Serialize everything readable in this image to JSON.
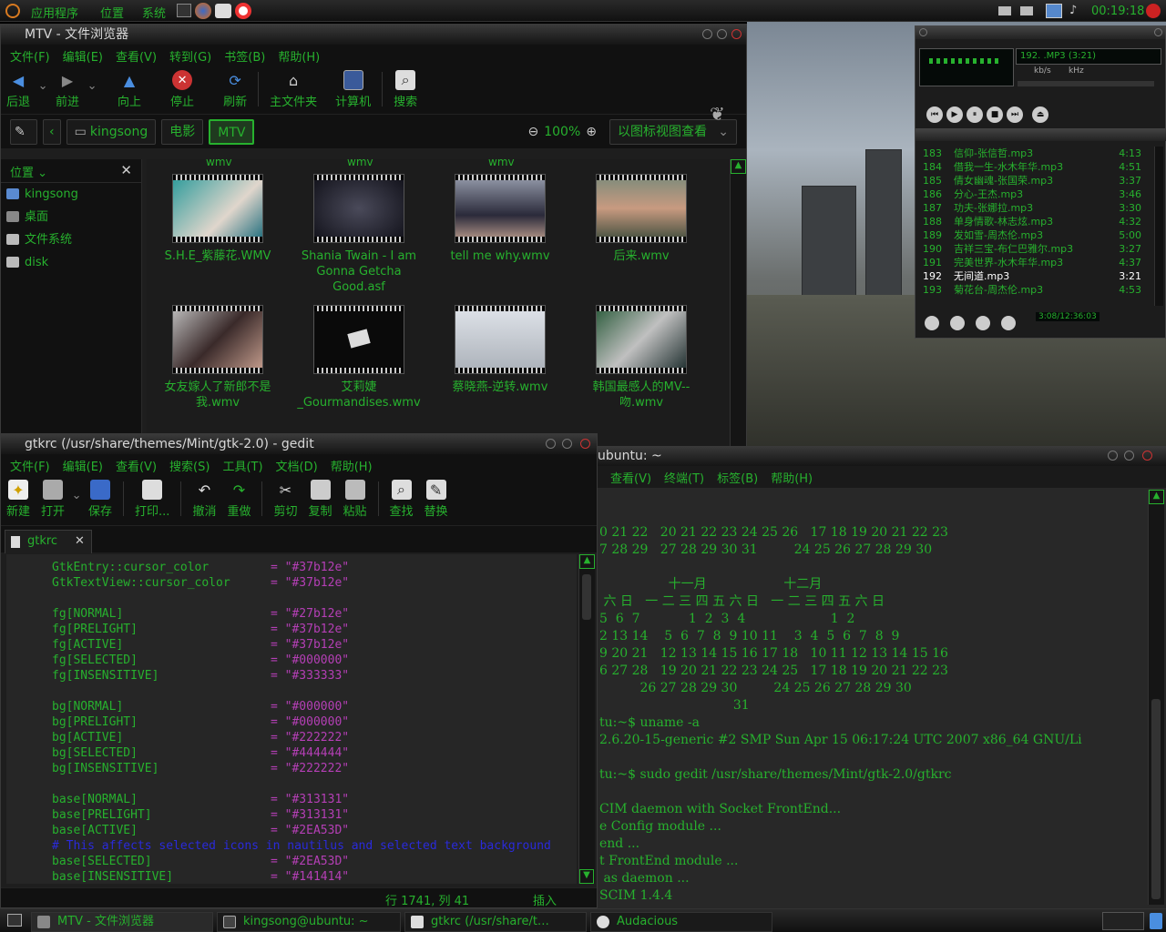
{
  "top_panel": {
    "menus": [
      "应用程序",
      "位置",
      "系统"
    ],
    "clock": "00:19:18"
  },
  "nautilus": {
    "title": "MTV - 文件浏览器",
    "menus": [
      "文件(F)",
      "编辑(E)",
      "查看(V)",
      "转到(G)",
      "书签(B)",
      "帮助(H)"
    ],
    "toolbar": [
      "后退",
      "前进",
      "向上",
      "停止",
      "刷新",
      "主文件夹",
      "计算机",
      "搜索"
    ],
    "path": [
      "kingsong",
      "电影",
      "MTV"
    ],
    "zoom": "100%",
    "view_mode": "以图标视图查看",
    "sidebar_title": "位置",
    "sidebar_items": [
      "kingsong",
      "桌面",
      "文件系统",
      "disk"
    ],
    "prev_row_labels": [
      "wmv",
      "wmv",
      "wmv"
    ],
    "files": [
      {
        "name": "S.H.E_紫藤花.WMV",
        "thumb": "#1a8a8a"
      },
      {
        "name": "Shania Twain - I am Gonna Getcha Good.asf",
        "thumb": "#2a2f3a"
      },
      {
        "name": "tell me why.wmv",
        "thumb": "#3a3a4a"
      },
      {
        "name": "后来.wmv",
        "thumb": "#4a5a4a"
      },
      {
        "name": "女友嫁人了新郎不是我.wmv",
        "thumb": "#5a4a4a"
      },
      {
        "name": "艾莉婕_Gourmandises.wmv",
        "thumb": "#101010"
      },
      {
        "name": "蔡晓燕-逆转.wmv",
        "thumb": "#c8ccd0"
      },
      {
        "name": "韩国最感人的MV--吻.wmv",
        "thumb": "#2a4a3a"
      }
    ]
  },
  "gedit": {
    "title": "gtkrc (/usr/share/themes/Mint/gtk-2.0) - gedit",
    "menus": [
      "文件(F)",
      "编辑(E)",
      "查看(V)",
      "搜索(S)",
      "工具(T)",
      "文档(D)",
      "帮助(H)"
    ],
    "toolbar": [
      "新建",
      "打开",
      "保存",
      "打印...",
      "撤消",
      "重做",
      "剪切",
      "复制",
      "粘贴",
      "查找",
      "替换"
    ],
    "tab": "gtkrc",
    "lines": [
      {
        "k": "GtkEntry::cursor_color",
        "v": "\"#37b12e\""
      },
      {
        "k": "GtkTextView::cursor_color",
        "v": "\"#37b12e\""
      },
      {
        "k": "",
        "v": ""
      },
      {
        "k": "fg[NORMAL]",
        "v": "\"#27b12e\""
      },
      {
        "k": "fg[PRELIGHT]",
        "v": "\"#37b12e\""
      },
      {
        "k": "fg[ACTIVE]",
        "v": "\"#37b12e\""
      },
      {
        "k": "fg[SELECTED]",
        "v": "\"#000000\""
      },
      {
        "k": "fg[INSENSITIVE]",
        "v": "\"#333333\""
      },
      {
        "k": "",
        "v": ""
      },
      {
        "k": "bg[NORMAL]",
        "v": "\"#000000\""
      },
      {
        "k": "bg[PRELIGHT]",
        "v": "\"#000000\""
      },
      {
        "k": "bg[ACTIVE]",
        "v": "\"#222222\""
      },
      {
        "k": "bg[SELECTED]",
        "v": "\"#444444\""
      },
      {
        "k": "bg[INSENSITIVE]",
        "v": "\"#222222\""
      },
      {
        "k": "",
        "v": ""
      },
      {
        "k": "base[NORMAL]",
        "v": "\"#313131\""
      },
      {
        "k": "base[PRELIGHT]",
        "v": "\"#313131\""
      },
      {
        "k": "base[ACTIVE]",
        "v": "\"#2EA53D\""
      },
      {
        "c": "# This affects selected icons in nautilus and selected text background"
      },
      {
        "k": "base[SELECTED]",
        "v": "\"#2EA53D\""
      },
      {
        "k": "base[INSENSITIVE]",
        "v": "\"#141414\""
      }
    ],
    "status_pos": "行 1741, 列 41",
    "status_mode": "插入"
  },
  "terminal": {
    "title": "ubuntu: ~",
    "menus": [
      "查看(V)",
      "终端(T)",
      "标签(B)",
      "帮助(H)"
    ],
    "lines": [
      "0 21 22   20 21 22 23 24 25 26   17 18 19 20 21 22 23",
      "7 28 29   27 28 29 30 31         24 25 26 27 28 29 30",
      "",
      "                 十一月                   十二月",
      " 六 日   一 二 三 四 五 六 日   一 二 三 四 五 六 日",
      "5  6  7            1  2  3  4                     1  2",
      "2 13 14    5  6  7  8  9 10 11    3  4  5  6  7  8  9",
      "9 20 21   12 13 14 15 16 17 18   10 11 12 13 14 15 16",
      "6 27 28   19 20 21 22 23 24 25   17 18 19 20 21 22 23",
      "          26 27 28 29 30         24 25 26 27 28 29 30",
      "                                 31",
      "tu:~$ uname -a",
      "2.6.20-15-generic #2 SMP Sun Apr 15 06:17:24 UTC 2007 x86_64 GNU/Li",
      "",
      "tu:~$ sudo gedit /usr/share/themes/Mint/gtk-2.0/gtkrc",
      "",
      "CIM daemon with Socket FrontEnd...",
      "e Config module ...",
      "end ...",
      "t FrontEnd module ...",
      " as daemon ...",
      "SCIM 1.4.4"
    ]
  },
  "audacious": {
    "display": "192. .MP3 (3:21)",
    "kbps": "kb/s",
    "khz": "kHz",
    "playlist": [
      {
        "n": "183",
        "t": "信仰-张信哲.mp3",
        "d": "4:13"
      },
      {
        "n": "184",
        "t": "借我一生-水木年华.mp3",
        "d": "4:51"
      },
      {
        "n": "185",
        "t": "倩女幽魂-张国荣.mp3",
        "d": "3:37"
      },
      {
        "n": "186",
        "t": "分心-王杰.mp3",
        "d": "3:46"
      },
      {
        "n": "187",
        "t": "功夫-张娜拉.mp3",
        "d": "3:30"
      },
      {
        "n": "188",
        "t": "单身情歌-林志炫.mp3",
        "d": "4:32"
      },
      {
        "n": "189",
        "t": "发如雪-周杰伦.mp3",
        "d": "5:00"
      },
      {
        "n": "190",
        "t": "吉祥三宝-布仁巴雅尔.mp3",
        "d": "3:27"
      },
      {
        "n": "191",
        "t": "完美世界-水木年华.mp3",
        "d": "4:37"
      },
      {
        "n": "192",
        "t": "无间道.mp3",
        "d": "3:21"
      },
      {
        "n": "193",
        "t": "菊花台-周杰伦.mp3",
        "d": "4:53"
      }
    ],
    "time_display": "3:08/12:36:03"
  },
  "taskbar": [
    {
      "label": "MTV - 文件浏览器"
    },
    {
      "label": "kingsong@ubuntu: ~"
    },
    {
      "label": "gtkrc (/usr/share/t…"
    },
    {
      "label": "Audacious"
    }
  ]
}
